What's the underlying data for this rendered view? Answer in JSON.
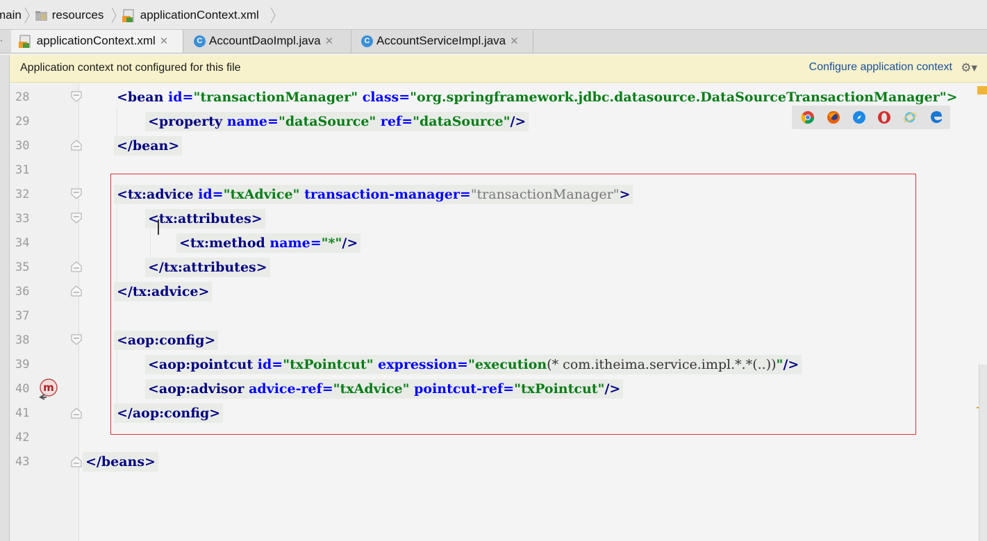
{
  "breadcrumb": {
    "items": [
      "main",
      "resources",
      "applicationContext.xml"
    ]
  },
  "tabs": [
    {
      "label": "applicationContext.xml",
      "icon": "xml-file-icon",
      "active": true
    },
    {
      "label": "AccountDaoImpl.java",
      "icon": "java-class-icon",
      "active": false
    },
    {
      "label": "AccountServiceImpl.java",
      "icon": "java-class-icon",
      "active": false
    }
  ],
  "notification": {
    "message": "Application context not configured for this file",
    "action": "Configure application context"
  },
  "browsers": [
    "chrome-icon",
    "firefox-icon",
    "safari-icon",
    "opera-icon",
    "ie-icon",
    "edge-icon"
  ],
  "editor": {
    "line_numbers": [
      "28",
      "29",
      "30",
      "31",
      "32",
      "33",
      "34",
      "35",
      "36",
      "37",
      "38",
      "39",
      "40",
      "41",
      "42",
      "43"
    ],
    "lines": {
      "l28": {
        "t1": "<bean ",
        "a1": "id=",
        "v1": "\"transactionManager\"",
        "a2": " class=",
        "v2": "\"org.springframework.jdbc.datasource.DataSourceTransactionManager\">"
      },
      "l29": {
        "t1": "<property ",
        "a1": "name=",
        "v1": "\"dataSource\"",
        "a2": " ref=",
        "v2": "\"dataSource\"",
        "t2": "/>"
      },
      "l30": {
        "t1": "</bean>"
      },
      "l32": {
        "t1": "<tx:advice ",
        "a1": "id=",
        "v1": "\"txAdvice\"",
        "a2": " transaction-manager=",
        "v2": "\"transactionManager\"",
        "t2": ">"
      },
      "l33": {
        "t1": "<tx:attributes>"
      },
      "l34": {
        "t1": "<tx:method ",
        "a1": "name=",
        "v1": "\"*\"",
        "t2": "/>"
      },
      "l35": {
        "t1": "</tx:attributes>"
      },
      "l36": {
        "t1": "</tx:advice>"
      },
      "l38": {
        "t1": "<aop:config>"
      },
      "l39": {
        "t1": "<aop:pointcut ",
        "a1": "id=",
        "v1": "\"txPointcut\"",
        "a2": " expression=",
        "v2a": "\"execution",
        "v2b": "(* com.itheima.service.impl.*.*(..))",
        "v2c": "\"",
        "t2": "/>"
      },
      "l40": {
        "t1": "<aop:advisor ",
        "a1": "advice-ref=",
        "v1": "\"txAdvice\"",
        "a2": " pointcut-ref=",
        "v2": "\"txPointcut\"",
        "t2": "/>"
      },
      "l41": {
        "t1": "</aop:config>"
      },
      "l43": {
        "t1": "</beans>"
      }
    }
  },
  "colors": {
    "tag": "#000080",
    "attr": "#0000ff",
    "value": "#067d17",
    "highlight_box": "#e03030",
    "notification_bg": "#f7f2cc"
  }
}
